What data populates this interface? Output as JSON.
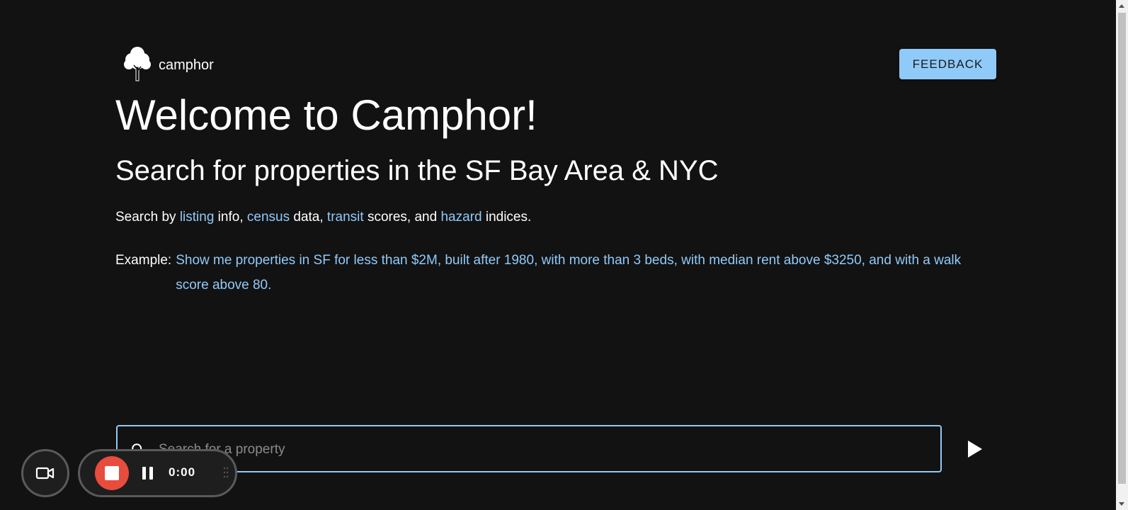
{
  "app": {
    "logo_text": "camphor",
    "feedback_label": "FEEDBACK"
  },
  "hero": {
    "title": "Welcome to Camphor!",
    "subtitle": "Search for properties in the SF Bay Area & NYC"
  },
  "search_by": {
    "prefix": "Search by ",
    "listing": "listing",
    "after_listing": " info, ",
    "census": "census",
    "after_census": " data, ",
    "transit": "transit",
    "after_transit": " scores, and ",
    "hazard": "hazard",
    "after_hazard": " indices."
  },
  "example": {
    "label": "Example:",
    "text": "Show me properties in SF for less than $2M, built after 1980, with more than 3 beds, with median rent above $3250, and with a walk score above 80."
  },
  "search": {
    "placeholder": "Search for a property",
    "value": ""
  },
  "recorder": {
    "timer": "0:00"
  },
  "colors": {
    "background": "#121212",
    "accent": "#90caf9",
    "record_red": "#e84c3d"
  },
  "icons": {
    "logo": "tree-icon",
    "search": "search-icon",
    "send": "play-arrow-icon",
    "camera": "video-camera-icon",
    "stop": "stop-icon",
    "pause": "pause-icon"
  }
}
